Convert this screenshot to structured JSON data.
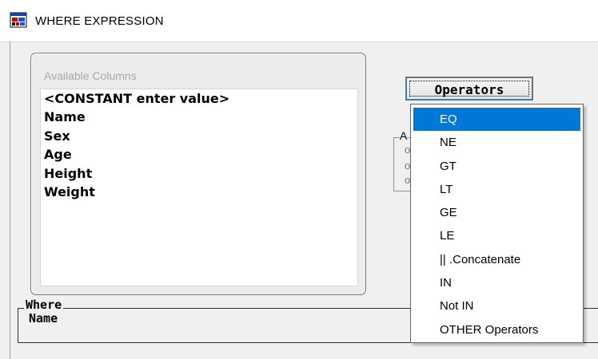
{
  "window": {
    "title": "WHERE EXPRESSION",
    "icon": "sas-app-icon"
  },
  "available_columns": {
    "caption": "Available Columns",
    "items": [
      "<CONSTANT enter value>",
      "Name",
      "Sex",
      "Age",
      "Height",
      "Weight"
    ]
  },
  "operators": {
    "button_label": "Operators",
    "selected": "EQ",
    "items": [
      "EQ",
      "NE",
      "GT",
      "LT",
      "GE",
      "LE",
      "|| .Concatenate",
      "IN",
      "Not IN",
      "OTHER Operators"
    ],
    "highlight_color": "#0078d7"
  },
  "obscured_group": {
    "label_fragment": "A",
    "item_fragments": [
      "o",
      "o",
      "o"
    ]
  },
  "where_clause": {
    "label": "Where",
    "value": "Name"
  }
}
